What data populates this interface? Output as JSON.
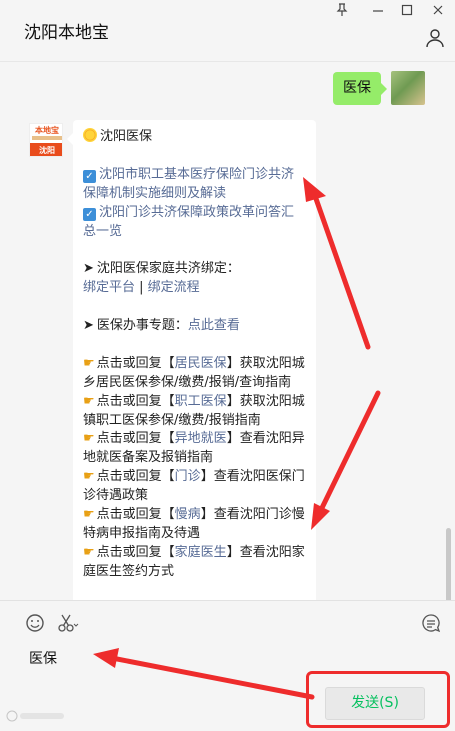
{
  "window": {
    "title": "沈阳本地宝",
    "controls": [
      "pin",
      "minimize",
      "maximize",
      "close"
    ]
  },
  "messages": {
    "me": {
      "text": "医保"
    },
    "account": {
      "logo_top": "本地宝",
      "logo_bottom": "沈阳",
      "heading": "沈阳医保",
      "items": [
        {
          "text": "沈阳市职工基本医疗保险门诊共济保障机制实施细则及解读"
        },
        {
          "text": "沈阳门诊共济保障政策改革问答汇总一览"
        }
      ],
      "family_title": "沈阳医保家庭共济绑定：",
      "family_link1": "绑定平台",
      "family_sep": " | ",
      "family_link2": "绑定流程",
      "topics_title": "医保办事专题：",
      "topics_link": "点此查看",
      "replies": [
        {
          "prefix": "点击或回复【",
          "keyword": "居民医保",
          "suffix": "】获取沈阳城乡居民医保参保/缴费/报销/查询指南"
        },
        {
          "prefix": "点击或回复【",
          "keyword": "职工医保",
          "suffix": "】获取沈阳城镇职工医保参保/缴费/报销指南"
        },
        {
          "prefix": "点击或回复【",
          "keyword": "异地就医",
          "suffix": "】查看沈阳异地就医备案及报销指南"
        },
        {
          "prefix": "点击或回复【",
          "keyword": "门诊",
          "suffix": "】查看沈阳医保门诊待遇政策"
        },
        {
          "prefix": "点击或回复【",
          "keyword": "慢病",
          "suffix": "】查看沈阳门诊慢特病申报指南及待遇"
        },
        {
          "prefix": "点击或回复【",
          "keyword": "家庭医生",
          "suffix": "】查看沈阳家庭医生签约方式"
        }
      ]
    }
  },
  "input": {
    "text": "医保"
  },
  "toolbar": {
    "send_label": "发送(S)"
  },
  "icons": [
    "emoji-icon",
    "scissors-icon",
    "chat-history-icon",
    "person-icon",
    "pin-icon",
    "minimize-icon",
    "maximize-icon",
    "close-icon"
  ],
  "colors": {
    "accent": "#07c160",
    "bubble_me": "#95ec69",
    "link": "#576b95",
    "annotation": "#ee2c2c"
  }
}
